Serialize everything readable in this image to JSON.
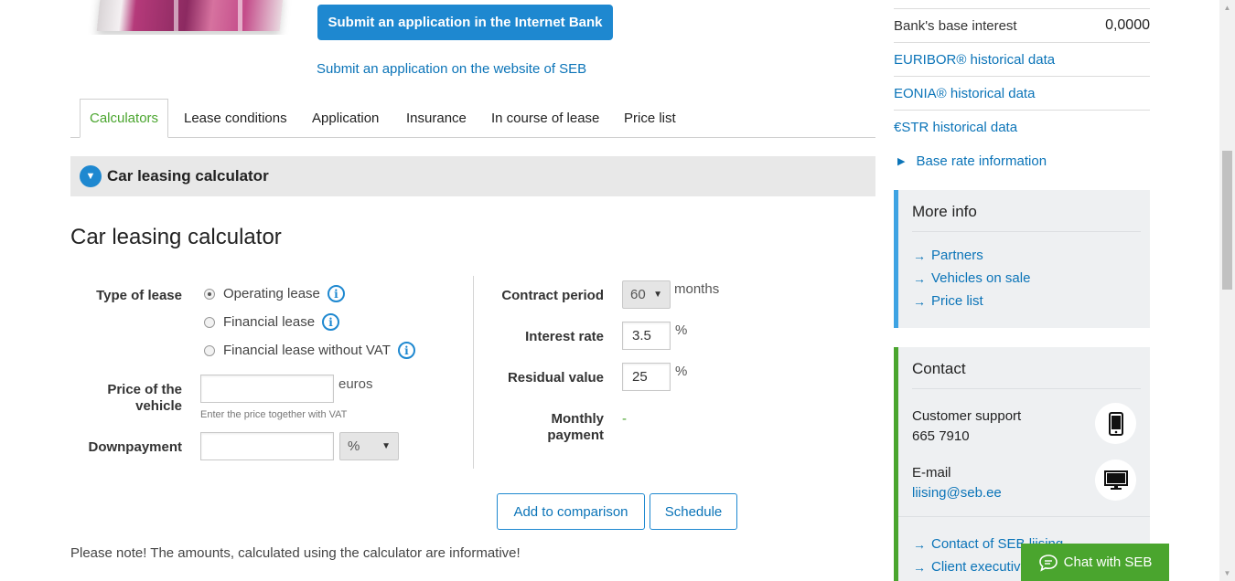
{
  "main": {
    "internet_bank_button": "Submit an application in the Internet Bank",
    "website_link": "Submit an application on the website of SEB",
    "tabs": [
      {
        "label": "Calculators"
      },
      {
        "label": "Lease conditions"
      },
      {
        "label": "Application"
      },
      {
        "label": "Insurance"
      },
      {
        "label": "In course of lease"
      },
      {
        "label": "Price list"
      }
    ],
    "accordion_title": "Car leasing calculator",
    "calc_title": "Car leasing calculator",
    "form": {
      "type_of_lease_label": "Type of lease",
      "lease_options": [
        "Operating lease",
        "Financial lease",
        "Financial lease without VAT"
      ],
      "selected_lease": "Operating lease",
      "price_label": "Price of the vehicle",
      "price_value": "",
      "price_unit": "euros",
      "price_hint": "Enter the price together with VAT",
      "downpayment_label": "Downpayment",
      "downpayment_value": "",
      "downpayment_unit_select": "%",
      "contract_period_label": "Contract period",
      "contract_period_value": "60",
      "contract_period_unit": "months",
      "interest_rate_label": "Interest rate",
      "interest_rate_value": "3.5",
      "interest_rate_unit": "%",
      "residual_value_label": "Residual value",
      "residual_value_value": "25",
      "residual_value_unit": "%",
      "monthly_payment_label": "Monthly payment",
      "monthly_payment_value": "-"
    },
    "add_to_comparison": "Add to comparison",
    "schedule": "Schedule",
    "note": "Please note! The amounts, calculated using the calculator are informative!"
  },
  "sidebar": {
    "base_interest_label": "Bank's base interest",
    "base_interest_value": "0,0000",
    "links": [
      "EURIBOR® historical data",
      "EONIA® historical data",
      "€STR historical data"
    ],
    "base_rate_info": "Base rate information",
    "more_info": {
      "title": "More info",
      "links": [
        "Partners",
        "Vehicles on sale",
        "Price list"
      ]
    },
    "contact": {
      "title": "Contact",
      "support_label": "Customer support",
      "support_phone": "665 7910",
      "email_label": "E-mail",
      "email": "liising@seb.ee",
      "links": [
        "Contact of SEB liising",
        "Client executives"
      ]
    }
  },
  "chat": {
    "label": "Chat with SEB"
  },
  "colors": {
    "brand_blue": "#1e88d0",
    "brand_green": "#4aa52e",
    "link": "#0b74b8"
  }
}
